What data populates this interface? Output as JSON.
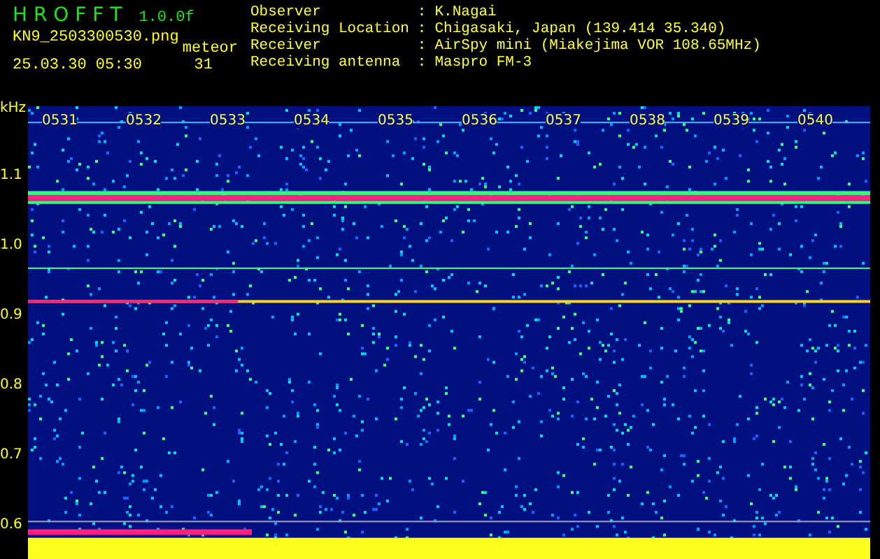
{
  "header": {
    "title": "H R O F F T",
    "version": "1.0.0f",
    "file_name": "KN9_2503300530.png",
    "date_time": "25.03.30 05:30",
    "count_label": "meteor",
    "count": "31"
  },
  "info": [
    {
      "label": "Observer",
      "separator": ":",
      "value": "K.Nagai"
    },
    {
      "label": "Receiving Location",
      "separator": ":",
      "value": "Chigasaki, Japan (139.414 35.340)"
    },
    {
      "label": "Receiver",
      "separator": ":",
      "value": "AirSpy mini (Miakejima VOR 108.65MHz)"
    },
    {
      "label": "Receiving antenna",
      "separator": ":",
      "value": "Maspro FM-3"
    }
  ],
  "spectrogram": {
    "unit": "kHz",
    "y_ticks": [
      "1.1",
      "1.0",
      "0.9",
      "0.8",
      "0.7",
      "0.6"
    ],
    "time_labels": [
      "0531",
      "0532",
      "0533",
      "0534",
      "0535",
      "0536",
      "0537",
      "0538",
      "0539",
      "0540"
    ]
  }
}
